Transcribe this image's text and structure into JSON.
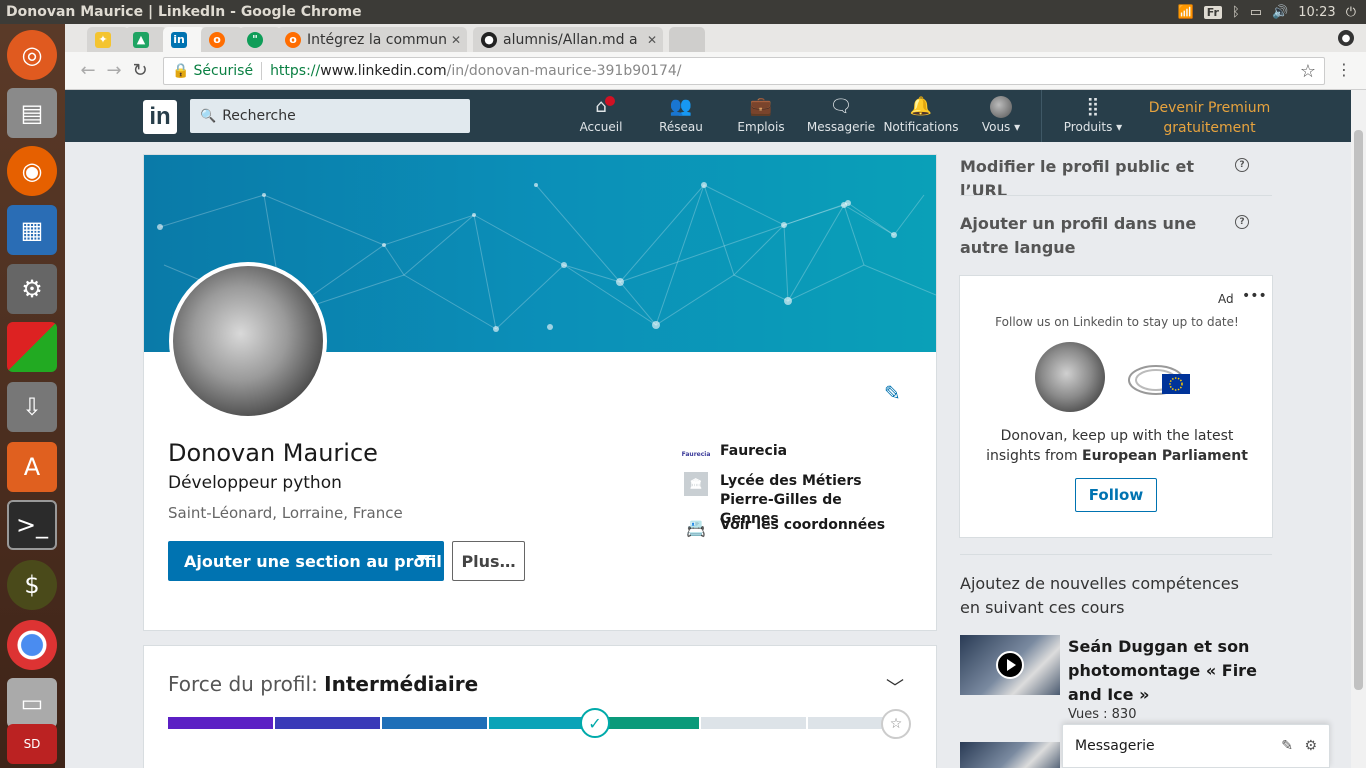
{
  "os": {
    "window_title": "Donovan Maurice | LinkedIn - Google Chrome",
    "keyboard": "Fr",
    "clock": "10:23"
  },
  "browser": {
    "tabs": [
      {
        "title": "",
        "favicon": "bird-icon",
        "color": "#f4c430"
      },
      {
        "title": "",
        "favicon": "drive-icon",
        "color": "#1fa463"
      },
      {
        "title": "",
        "favicon": "linkedin-icon",
        "color": "#0073b1",
        "active": true
      },
      {
        "title": "",
        "favicon": "openclassrooms-icon",
        "color": "#ff6d00"
      },
      {
        "title": "",
        "favicon": "hangouts-icon",
        "color": "#0f9d58"
      },
      {
        "title": "Intégrez la commun",
        "favicon": "openclassrooms-icon",
        "color": "#ff6d00"
      },
      {
        "title": "alumnis/Allan.md a",
        "favicon": "github-icon",
        "color": "#222222"
      }
    ],
    "secure_label": "Sécurisé",
    "url_scheme": "https://",
    "url_host": "www.linkedin.com",
    "url_path": "/in/donovan-maurice-391b90174/"
  },
  "linkedin": {
    "logo": "in",
    "search_placeholder": "Recherche",
    "nav": [
      {
        "label": "Accueil",
        "icon": "home-icon"
      },
      {
        "label": "Réseau",
        "icon": "people-icon"
      },
      {
        "label": "Emplois",
        "icon": "briefcase-icon"
      },
      {
        "label": "Messagerie",
        "icon": "messages-icon"
      },
      {
        "label": "Notifications",
        "icon": "bell-icon"
      },
      {
        "label": "Vous",
        "icon": "avatar-icon"
      },
      {
        "label": "Produits",
        "icon": "grid-icon"
      }
    ],
    "premium": "Devenir Premium gratuitement",
    "brand_color": "#0073b1",
    "nav_bg": "#283e4a"
  },
  "profile": {
    "name": "Donovan Maurice",
    "headline": "Développeur python",
    "location": "Saint-Léonard, Lorraine, France",
    "add_section": "Ajouter une section au profil",
    "more": "Plus…",
    "company": "Faurecia",
    "company_logo": "Faurecia",
    "school": "Lycée des Métiers Pierre-Gilles de Gennes",
    "contact": "Voir les coordonnées"
  },
  "strength": {
    "label": "Force du profil:",
    "level": "Intermédiaire",
    "segments_filled": 5,
    "segments_total": 7
  },
  "rail": {
    "public_profile": "Modifier le profil public et l’URL",
    "other_language": "Ajouter un profil dans une autre langue",
    "ad": {
      "label": "Ad",
      "subtitle": "Follow us on Linkedin to stay up to date!",
      "text_prefix": "Donovan, keep up with the latest insights from ",
      "text_org": "European Parliament",
      "follow": "Follow"
    },
    "courses_title": "Ajoutez de nouvelles compétences en suivant ces cours",
    "course": {
      "title": "Seán Duggan et son photomontage « Fire and Ice »",
      "views": "Vues : 830"
    },
    "messaging": "Messagerie"
  }
}
